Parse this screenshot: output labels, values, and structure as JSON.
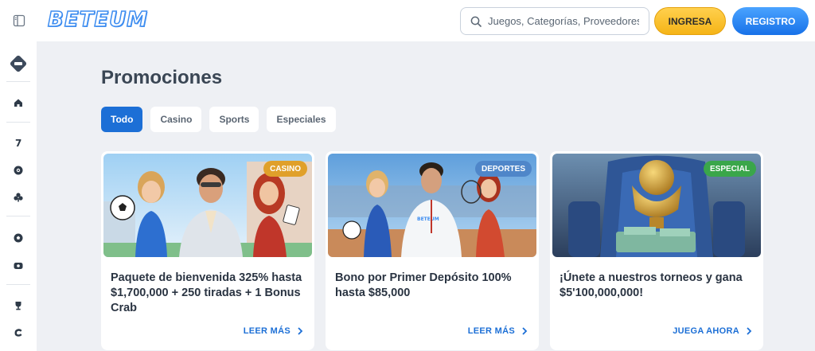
{
  "header": {
    "brand": "BETEUM",
    "search_placeholder": "Juegos, Categorías, Proveedores",
    "login_label": "INGRESA",
    "register_label": "REGISTRO"
  },
  "sidebar": {
    "items": [
      {
        "icon": "diamond-logo-icon"
      },
      {
        "icon": "home-icon"
      },
      {
        "icon": "slot-seven-icon"
      },
      {
        "icon": "roulette-icon"
      },
      {
        "icon": "club-card-icon"
      },
      {
        "icon": "soccer-ball-icon"
      },
      {
        "icon": "live-video-icon"
      },
      {
        "icon": "trophy-icon"
      },
      {
        "icon": "fast-c-icon"
      }
    ]
  },
  "main": {
    "title": "Promociones",
    "tabs": [
      {
        "label": "Todo",
        "active": true
      },
      {
        "label": "Casino",
        "active": false
      },
      {
        "label": "Sports",
        "active": false
      },
      {
        "label": "Especiales",
        "active": false
      }
    ],
    "cards": [
      {
        "badge": "CASINO",
        "badge_color": "#e0a02a",
        "title": "Paquete de bienvenida 325% hasta $1,700,000 + 250 tiradas + 1 Bonus Crab",
        "cta": "LEER MÁS"
      },
      {
        "badge": "DEPORTES",
        "badge_color": "#4f86c9",
        "title": "Bono por Primer Depósito 100% hasta $85,000",
        "cta": "LEER MÁS"
      },
      {
        "badge": "ESPECIAL",
        "badge_color": "#3aa64a",
        "title": "¡Únete a nuestros torneos y gana $5'100,000,000!",
        "cta": "JUEGA AHORA"
      }
    ]
  },
  "colors": {
    "accent": "#1c6fd6",
    "login_yellow": "#f5b417",
    "register_blue": "#1771e8",
    "background": "#eef0f4"
  }
}
